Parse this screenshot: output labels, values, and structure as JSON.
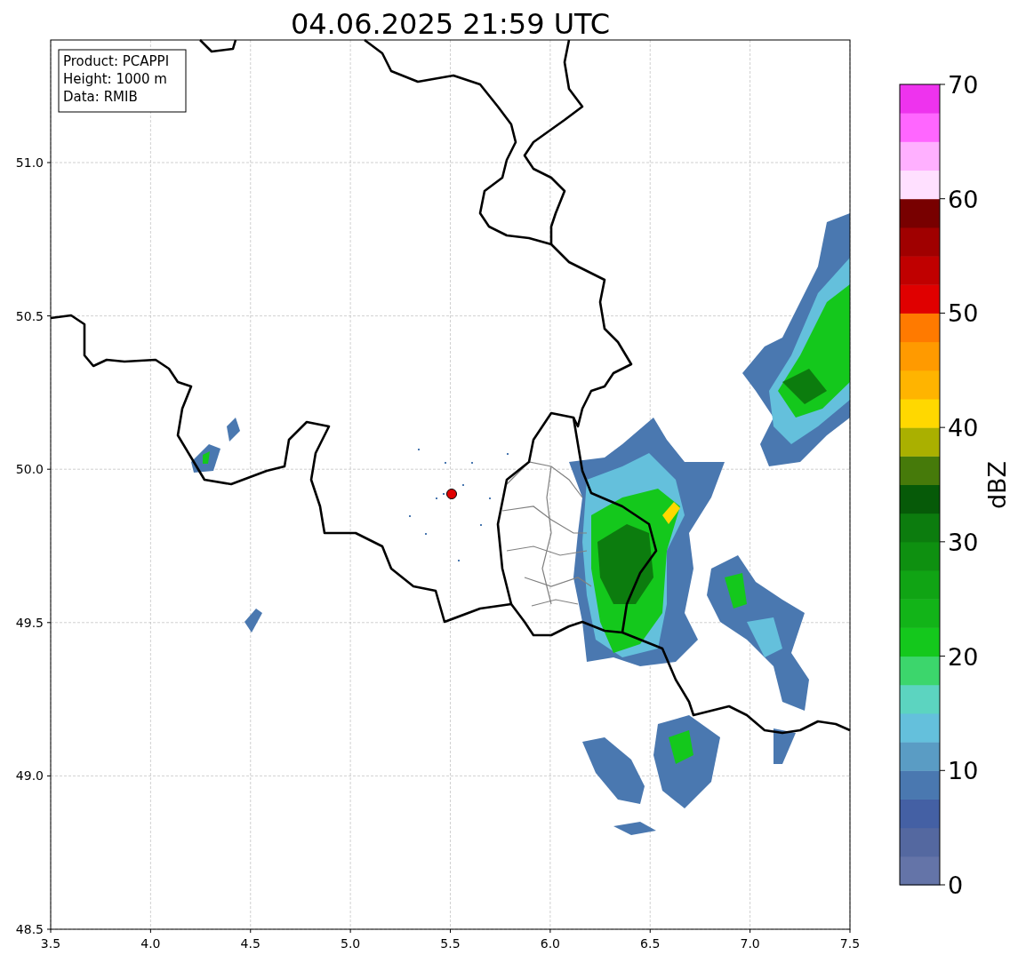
{
  "title": "04.06.2025 21:59 UTC",
  "info_box": [
    "Product: PCAPPI",
    "Height: 1000 m",
    "Data: RMIB"
  ],
  "x_ticks": [
    "3.5",
    "4.0",
    "4.5",
    "5.0",
    "5.5",
    "6.0",
    "6.5",
    "7.0",
    "7.5"
  ],
  "y_ticks": [
    "51.0",
    "50.5",
    "50.0",
    "49.5",
    "49.0",
    "48.5"
  ],
  "colorbar": {
    "label": "dBZ",
    "ticks": [
      "70",
      "60",
      "50",
      "40",
      "30",
      "20",
      "10",
      "0"
    ],
    "bands": [
      {
        "color": "#6474a8"
      },
      {
        "color": "#5468a0"
      },
      {
        "color": "#4460a4"
      },
      {
        "color": "#4a78b0"
      },
      {
        "color": "#5a9cc4"
      },
      {
        "color": "#64c0dc"
      },
      {
        "color": "#5cd4c0"
      },
      {
        "color": "#3cd66c"
      },
      {
        "color": "#14c81c"
      },
      {
        "color": "#12b418"
      },
      {
        "color": "#10a414"
      },
      {
        "color": "#0e9010"
      },
      {
        "color": "#0c7c0e"
      },
      {
        "color": "#065a08"
      },
      {
        "color": "#467a0a"
      },
      {
        "color": "#aab000"
      },
      {
        "color": "#ffd800"
      },
      {
        "color": "#ffb400"
      },
      {
        "color": "#ff9a00"
      },
      {
        "color": "#ff7a00"
      },
      {
        "color": "#e00000"
      },
      {
        "color": "#c00000"
      },
      {
        "color": "#a00000"
      },
      {
        "color": "#780000"
      },
      {
        "color": "#ffe0ff"
      },
      {
        "color": "#ffb0ff"
      },
      {
        "color": "#ff66ff"
      },
      {
        "color": "#ee33ee"
      }
    ]
  }
}
